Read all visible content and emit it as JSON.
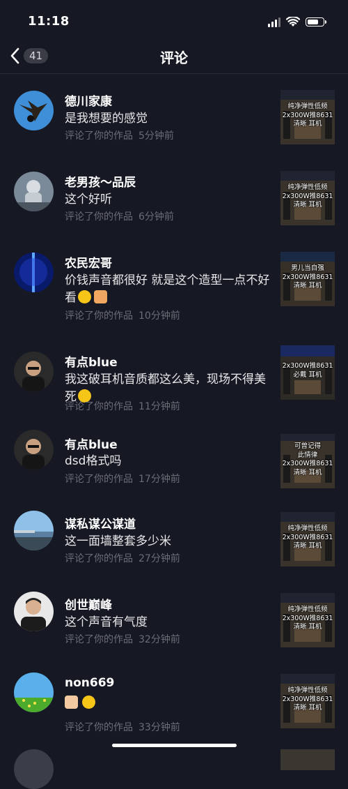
{
  "status_bar": {
    "time": "11:18",
    "battery_level": 0.75
  },
  "nav": {
    "title": "评论",
    "count": "41"
  },
  "comments": [
    {
      "name": "德川家康",
      "text": "是我想要的感觉",
      "action": "评论了你的作品",
      "time": "5分钟前",
      "thumb_caption": [
        "纯净弹性低频",
        "2x300W推8631",
        "清晰 耳机"
      ]
    },
    {
      "name": "老男孩～品辰",
      "text": "这个好听",
      "action": "评论了你的作品",
      "time": "6分钟前",
      "thumb_caption": [
        "纯净弹性低频",
        "2x300W推8631",
        "清晰 耳机"
      ]
    },
    {
      "name": "农民宏哥",
      "text": "价钱声音都很好 就是这个造型一点不好看",
      "action": "评论了你的作品",
      "time": "10分钟前",
      "thumb_caption": [
        "男儿当自强",
        "2x300W推8631",
        "清晰 耳机"
      ]
    },
    {
      "name": "有点blue",
      "text": "我这破耳机音质都这么美，现场不得美死",
      "action": "评论了你的作品",
      "time": "11分钟前",
      "thumb_caption": [
        "",
        "2x300W推8631",
        "必戴 耳机"
      ]
    },
    {
      "name": "有点blue",
      "text": "dsd格式吗",
      "action": "评论了你的作品",
      "time": "17分钟前",
      "thumb_caption": [
        "可曾记得",
        "此情律",
        "2x300W推8631",
        "清晰 耳机"
      ]
    },
    {
      "name": "谋私谋公谋道",
      "text": "这一面墙整套多少米",
      "action": "评论了你的作品",
      "time": "27分钟前",
      "thumb_caption": [
        "纯净弹性低频",
        "2x300W推8631",
        "清晰 耳机"
      ]
    },
    {
      "name": "创世巅峰",
      "text": "这个声音有气度",
      "action": "评论了你的作品",
      "time": "32分钟前",
      "thumb_caption": [
        "纯净弹性低频",
        "2x300W推8631",
        "清晰 耳机"
      ]
    },
    {
      "name": "non669",
      "text": "",
      "action": "评论了你的作品",
      "time": "33分钟前",
      "thumb_caption": [
        "纯净弹性低频",
        "2x300W推8631",
        "清晰 耳机"
      ]
    }
  ],
  "icons": {
    "back": "chevron-left-icon",
    "emoji_grin": "grinning-face-emoji-icon",
    "emoji_thumbs_up": "thumbs-up-emoji-icon",
    "emoji_rofl": "rolling-laughing-emoji-icon",
    "emoji_ok": "ok-hand-emoji-icon",
    "emoji_scared": "scared-face-emoji-icon"
  },
  "colors": {
    "background": "#161823",
    "meta_text": "#6b6d77",
    "divider": "#2a2c37"
  }
}
